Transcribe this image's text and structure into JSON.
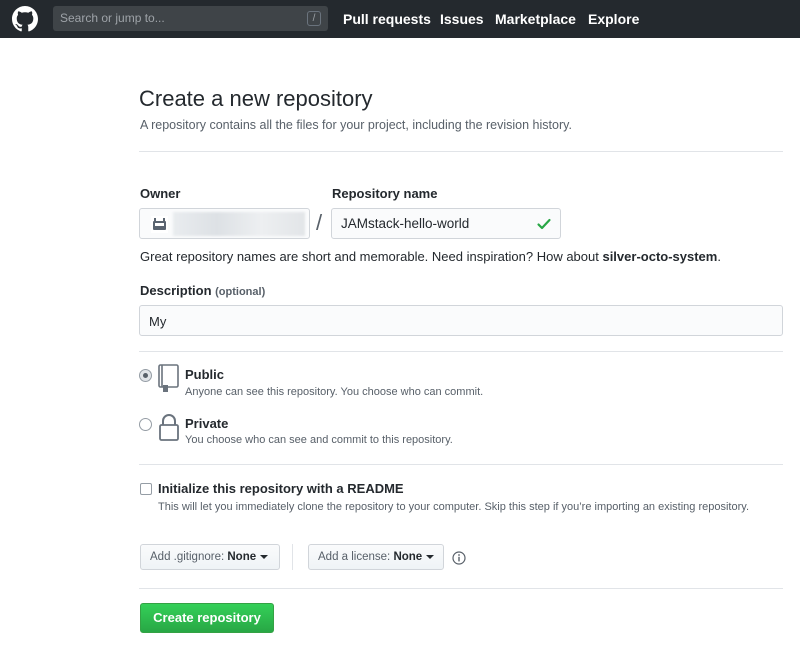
{
  "header": {
    "search_placeholder": "Search or jump to...",
    "search_shortcut": "/",
    "nav": [
      "Pull requests",
      "Issues",
      "Marketplace",
      "Explore"
    ]
  },
  "page": {
    "title": "Create a new repository",
    "subtitle": "A repository contains all the files for your project, including the revision history."
  },
  "form": {
    "owner_label": "Owner",
    "separator": "/",
    "repo_label": "Repository name",
    "repo_value": "JAMstack-hello-world",
    "hint_prefix": "Great repository names are short and memorable. Need inspiration? How about ",
    "hint_suggestion": "silver-octo-system",
    "hint_suffix": ".",
    "description_label": "Description",
    "description_optional": "(optional)",
    "description_value": "My"
  },
  "visibility": {
    "public_title": "Public",
    "public_desc": "Anyone can see this repository. You choose who can commit.",
    "private_title": "Private",
    "private_desc": "You choose who can see and commit to this repository.",
    "selected": "public"
  },
  "readme": {
    "title": "Initialize this repository with a README",
    "desc": "This will let you immediately clone the repository to your computer. Skip this step if you’re importing an existing repository.",
    "checked": false
  },
  "dropdowns": {
    "gitignore_prefix": "Add .gitignore:",
    "gitignore_value": "None",
    "license_prefix": "Add a license:",
    "license_value": "None"
  },
  "actions": {
    "create_label": "Create repository"
  },
  "colors": {
    "header_bg": "#24292e",
    "primary_green": "#28a745",
    "valid_check": "#28a745"
  }
}
